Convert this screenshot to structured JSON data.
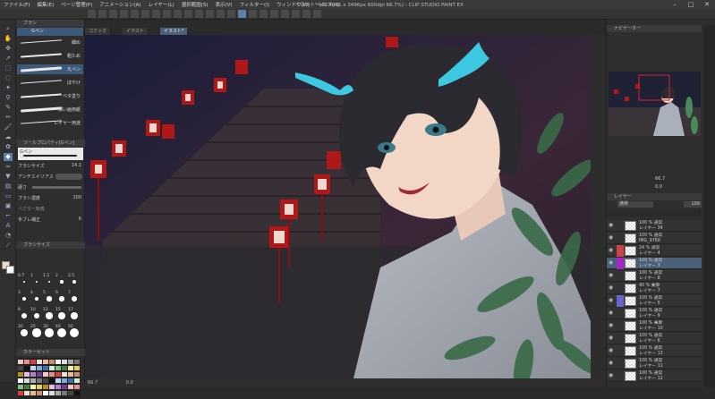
{
  "app": {
    "title": "イラスト* (A3 4961 x 3496px 600dpi 66.7%) - CLIP STUDIO PAINT EX"
  },
  "menu": [
    "ファイル(F)",
    "編集(E)",
    "ページ管理(P)",
    "アニメーション(A)",
    "レイヤー(L)",
    "選択範囲(S)",
    "表示(V)",
    "フィルター(I)",
    "ウィンドウ(W)",
    "ヘルプ(H)"
  ],
  "tabs": [
    "コミック",
    "イラスト",
    "イラスト*"
  ],
  "brush_panel": {
    "title": "ブラシ",
    "items": [
      {
        "label": "細め"
      },
      {
        "label": "粗ため"
      },
      {
        "label": "丸ペン"
      },
      {
        "label": "ぼやけ"
      },
      {
        "label": "ベタ塗り"
      },
      {
        "label": "細い画用紙"
      },
      {
        "label": "レイヤー用途"
      }
    ],
    "selected_tab": "Gペン"
  },
  "tool_property": {
    "title": "ツールプロパティ[Gペン]",
    "preview_label": "Gペン",
    "brush_size_label": "ブラシサイズ",
    "brush_size_value": "14.1",
    "antialias_label": "アンチエイリアス",
    "hardness_label": "硬さ",
    "density_label": "ブラシ濃度",
    "density_value": "100",
    "vector_label": "ベクター吸着",
    "stabilizer_label": "手ブレ補正",
    "stabilizer_value": "6"
  },
  "brush_size_panel": {
    "title": "ブラシサイズ",
    "sizes": [
      "0.7",
      "1",
      "1.5",
      "2",
      "2.5",
      "3",
      "4",
      "5",
      "6",
      "7",
      "8",
      "10",
      "12",
      "15",
      "17",
      "20",
      "25",
      "30",
      "40",
      "50"
    ]
  },
  "color_set": {
    "title": "カラーセット"
  },
  "status": {
    "zoom": "66.7",
    "coords": "0.0"
  },
  "right_panel": {
    "navigator_title": "ナビゲーター",
    "zoom": "66.7",
    "angle": "0.0",
    "layer_title": "レイヤー",
    "blend_mode": "通常",
    "opacity": "100"
  },
  "layers": [
    {
      "mode": "100 % 通常",
      "name": "レイヤー 34",
      "flag": ""
    },
    {
      "mode": "100 % 通常",
      "name": "IMG_9768",
      "flag": ""
    },
    {
      "mode": "24 % 通常",
      "name": "レイヤー 4",
      "flag": "#c44"
    },
    {
      "mode": "100 % 通常",
      "name": "レイヤー 3",
      "flag": "#a2c",
      "sel": true
    },
    {
      "mode": "100 % 通常",
      "name": "レイヤー 8",
      "flag": ""
    },
    {
      "mode": "40 % 乗算",
      "name": "レイヤー 7",
      "flag": ""
    },
    {
      "mode": "100 % 通常",
      "name": "レイヤー 5",
      "flag": "#66c"
    },
    {
      "mode": "100 % 通常",
      "name": "レイヤー 9",
      "flag": ""
    },
    {
      "mode": "100 % 乗算",
      "name": "レイヤー 10",
      "flag": ""
    },
    {
      "mode": "100 % 通常",
      "name": "レイヤー 6",
      "flag": ""
    },
    {
      "mode": "100 % 通常",
      "name": "レイヤー 13",
      "flag": ""
    },
    {
      "mode": "100 % 通常",
      "name": "レイヤー 11",
      "flag": ""
    },
    {
      "mode": "100 % 通常",
      "name": "レイヤー 12",
      "flag": ""
    }
  ],
  "colors": {
    "accent": "#4a5f78",
    "dragon_horn": "#3cc8e0",
    "lantern": "#b01818"
  }
}
